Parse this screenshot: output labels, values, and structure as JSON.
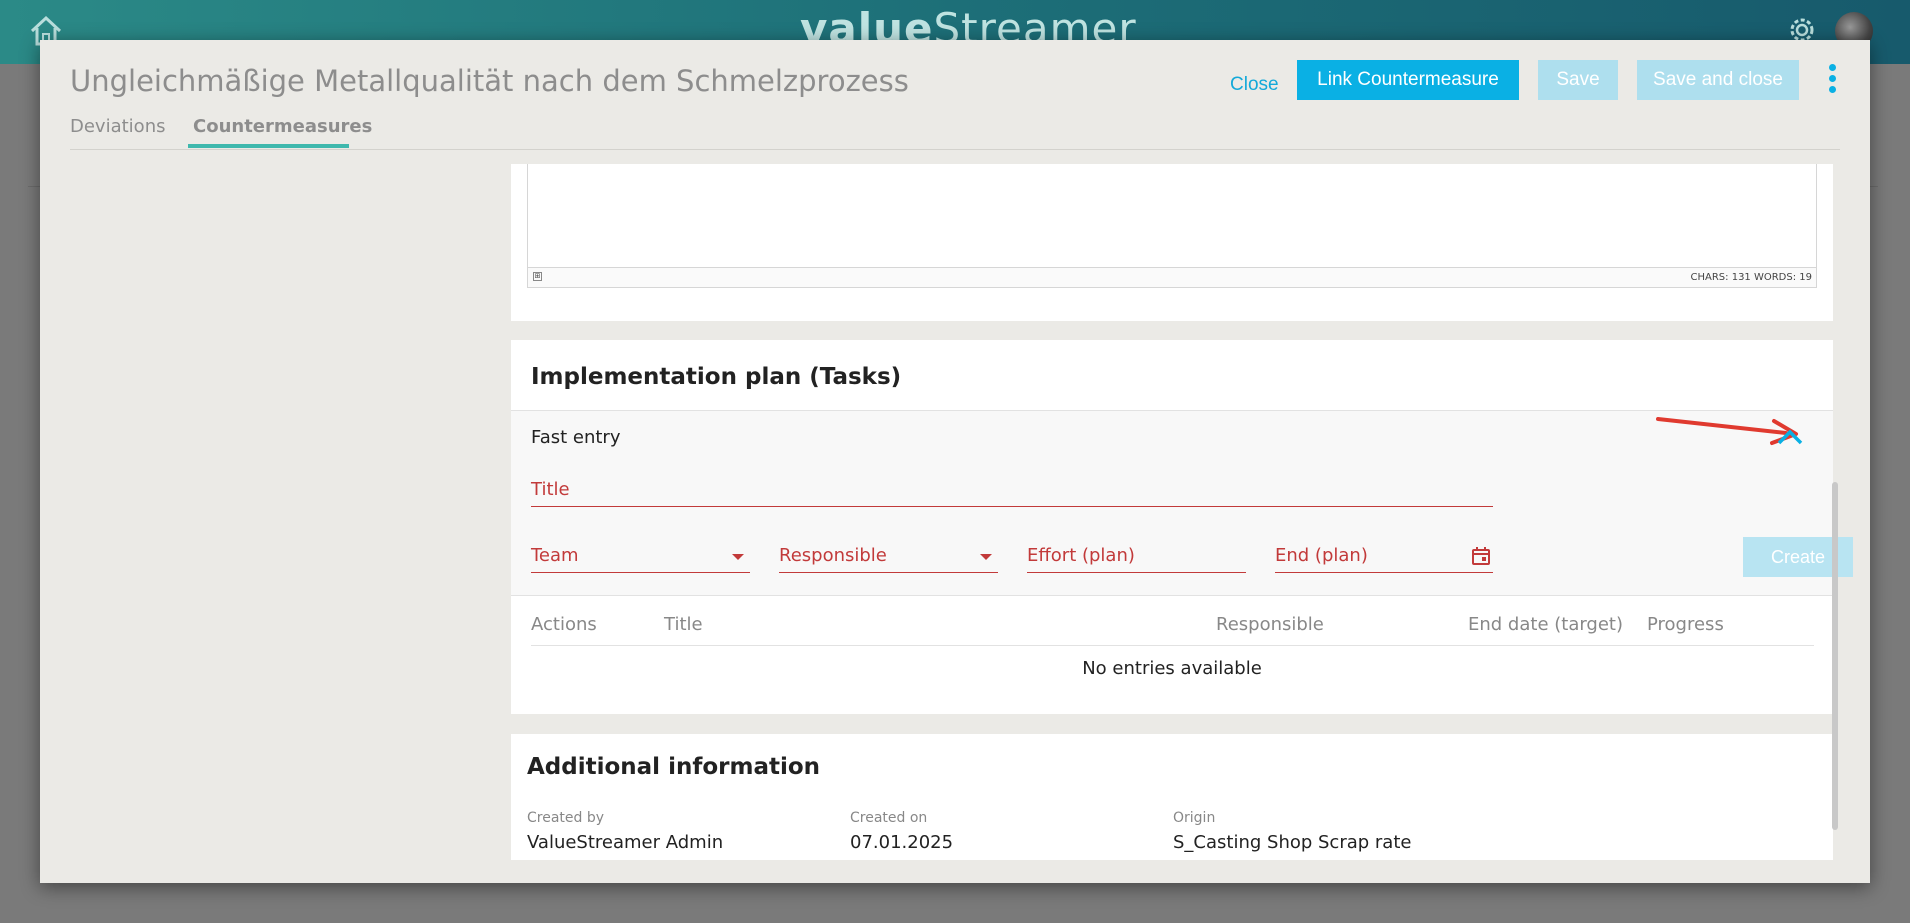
{
  "app": {
    "brand_value": "value",
    "brand_streamer": "Streamer"
  },
  "modal": {
    "title": "Ungleichmäßige Metallqualität nach dem Schmelzprozess",
    "buttons": {
      "close": "Close",
      "link": "Link Countermeasure",
      "save": "Save",
      "save_close": "Save and close"
    },
    "tabs": [
      {
        "label": "Deviations",
        "active": false
      },
      {
        "label": "Countermeasures",
        "active": true
      }
    ]
  },
  "editor": {
    "counts": "CHARS: 131   WORDS: 19"
  },
  "tasks": {
    "title": "Implementation plan (Tasks)",
    "fast_entry": {
      "label": "Fast entry",
      "title_placeholder": "Title",
      "team_placeholder": "Team",
      "responsible_placeholder": "Responsible",
      "effort_placeholder": "Effort (plan)",
      "end_placeholder": "End (plan)",
      "create": "Create"
    },
    "columns": [
      "Actions",
      "Title",
      "Responsible",
      "End date (target)",
      "Progress"
    ],
    "empty": "No entries available"
  },
  "additional": {
    "title": "Additional information",
    "fields": [
      {
        "label": "Created by",
        "value": "ValueStreamer Admin"
      },
      {
        "label": "Created on",
        "value": "07.01.2025"
      },
      {
        "label": "Origin",
        "value": "S_Casting Shop Scrap rate"
      }
    ]
  },
  "colors": {
    "accent": "#0ab0e4",
    "teal": "#3fb8ad",
    "error": "#c23a3a"
  }
}
